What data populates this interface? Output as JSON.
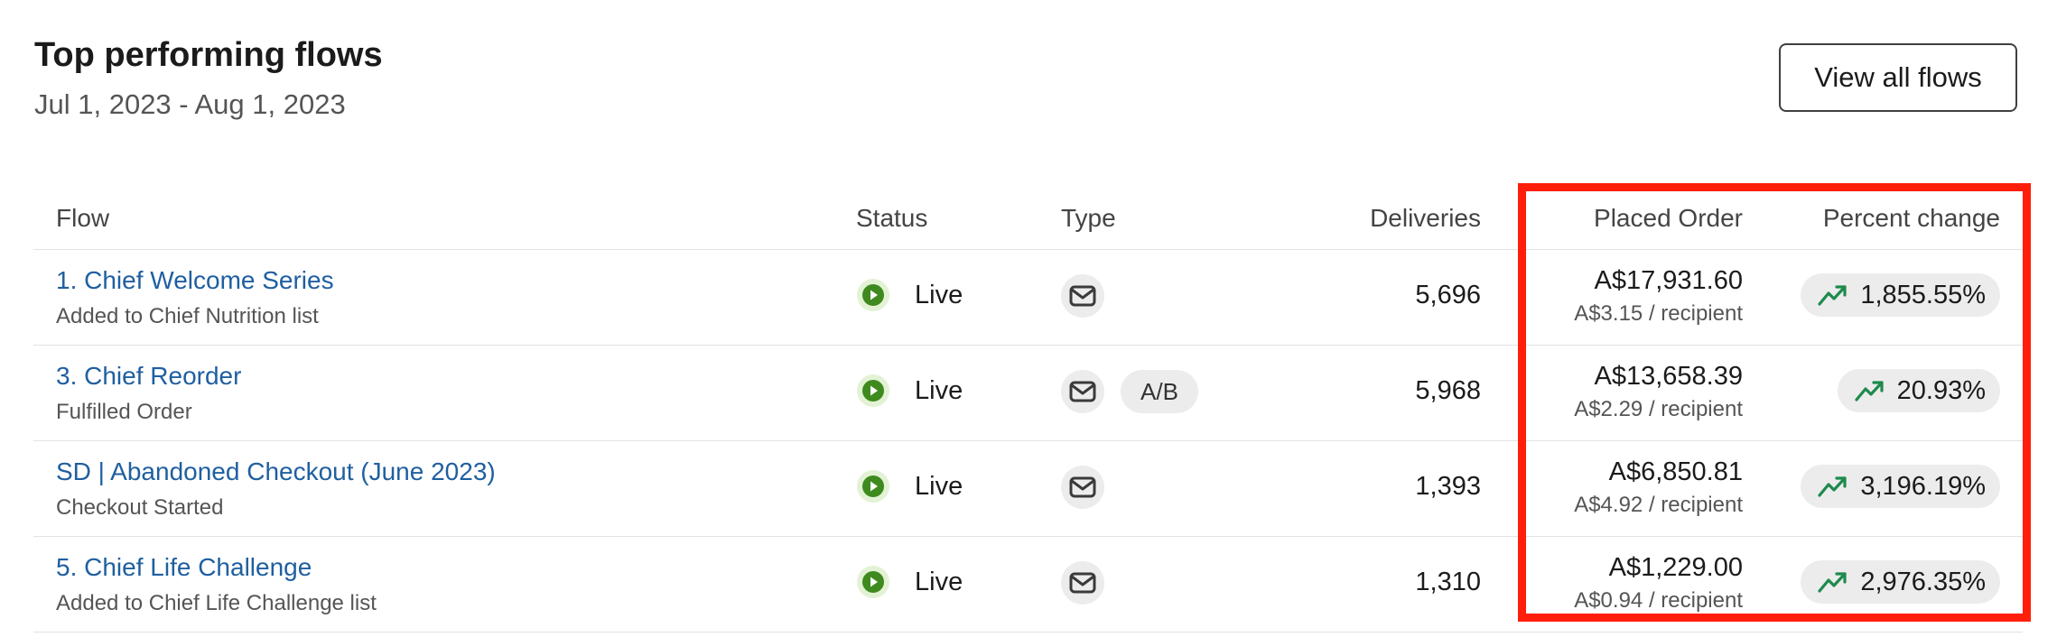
{
  "header": {
    "title": "Top performing flows",
    "date_range": "Jul 1, 2023 - Aug 1, 2023",
    "view_all_label": "View all flows"
  },
  "columns": {
    "flow": "Flow",
    "status": "Status",
    "type": "Type",
    "deliveries": "Deliveries",
    "placed_order": "Placed Order",
    "percent_change": "Percent change"
  },
  "rows": [
    {
      "name": "1. Chief Welcome Series",
      "trigger": "Added to Chief Nutrition list",
      "status": "Live",
      "type_icon": "mail-icon",
      "ab_label": "",
      "deliveries": "5,696",
      "placed_amount": "A$17,931.60",
      "per_recipient": "A$3.15 / recipient",
      "percent_change": "1,855.55%",
      "trend": "up"
    },
    {
      "name": "3. Chief Reorder",
      "trigger": "Fulfilled Order",
      "status": "Live",
      "type_icon": "mail-icon",
      "ab_label": "A/B",
      "deliveries": "5,968",
      "placed_amount": "A$13,658.39",
      "per_recipient": "A$2.29 / recipient",
      "percent_change": "20.93%",
      "trend": "up"
    },
    {
      "name": "SD | Abandoned Checkout (June 2023)",
      "trigger": "Checkout Started",
      "status": "Live",
      "type_icon": "mail-icon",
      "ab_label": "",
      "deliveries": "1,393",
      "placed_amount": "A$6,850.81",
      "per_recipient": "A$4.92 / recipient",
      "percent_change": "3,196.19%",
      "trend": "up"
    },
    {
      "name": "5. Chief Life Challenge",
      "trigger": "Added to Chief Life Challenge list",
      "status": "Live",
      "type_icon": "mail-icon",
      "ab_label": "",
      "deliveries": "1,310",
      "placed_amount": "A$1,229.00",
      "per_recipient": "A$0.94 / recipient",
      "percent_change": "2,976.35%",
      "trend": "up"
    }
  ],
  "colors": {
    "link": "#1f5fa0",
    "live_green": "#3f8a1e",
    "trend_green": "#1e8a4e",
    "highlight_red": "#ff1e0a"
  }
}
